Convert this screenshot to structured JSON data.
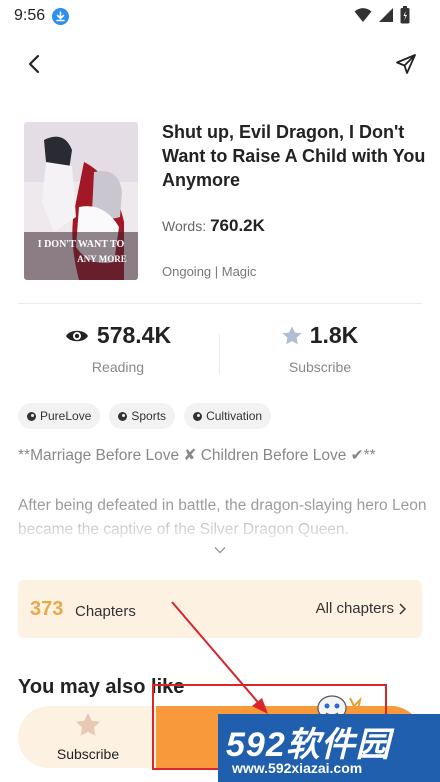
{
  "status_bar": {
    "time": "9:56"
  },
  "book": {
    "title": "Shut up, Evil Dragon, I Don't Want to Raise A Child with You Anymore",
    "words_label": "Words:",
    "words_value": "760.2K",
    "status": "Ongoing | Magic",
    "cover_text": [
      "I DON'T WANT TO",
      "ANY MORE"
    ]
  },
  "stats": {
    "reading": {
      "value": "578.4K",
      "label": "Reading"
    },
    "subscribe": {
      "value": "1.8K",
      "label": "Subscribe"
    }
  },
  "tags": [
    "PureLove",
    "Sports",
    "Cultivation"
  ],
  "synopsis": {
    "line1": "**Marriage Before Love ✘  Children Before Love ✔**",
    "line2": "After being defeated in battle, the dragon-slaying hero Leon became the captive of the Silver Dragon Queen."
  },
  "chapters": {
    "count": "373",
    "label": "Chapters",
    "all_label": "All chapters"
  },
  "section_title": "You may also like",
  "bottom_bar": {
    "subscribe_label": "Subscribe"
  },
  "watermark": {
    "logo": "592软件园",
    "url": "www.592xiazai.com"
  },
  "colors": {
    "accent": "#f89a3c",
    "chapter_count": "#e8a94a",
    "panel_bg": "#fdf1e2",
    "annotation": "#d8262a"
  }
}
